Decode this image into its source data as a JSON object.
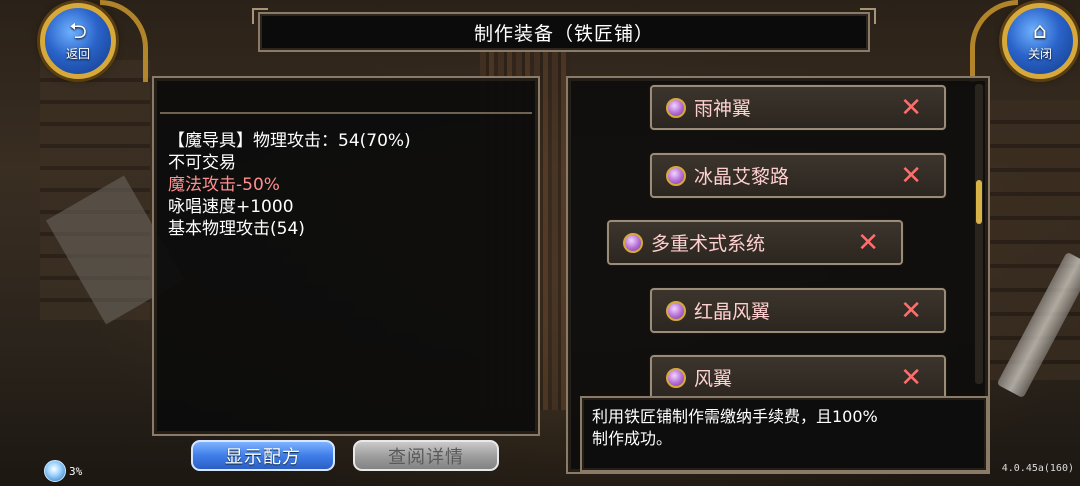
{
  "nav": {
    "back_icon": "return-arrow-icon",
    "back_label": "返回",
    "close_icon": "house-icon",
    "close_label": "关闭"
  },
  "title": "制作装备（铁匠铺）",
  "item_info": {
    "lines": [
      {
        "text": "【魔导具】物理攻击：54(70%)",
        "color": "#ffffff"
      },
      {
        "text": "不可交易",
        "color": "#ffffff"
      },
      {
        "text": "魔法攻击-50%",
        "color": "#ff8f8f"
      },
      {
        "text": "咏唱速度+1000",
        "color": "#ffffff"
      },
      {
        "text": "基本物理攻击(54)",
        "color": "#ffffff"
      }
    ]
  },
  "buttons": {
    "show_recipe": "显示配方",
    "view_details": "查阅详情"
  },
  "recipes": [
    {
      "name": "雨神翼",
      "icon": "purple-gem-icon",
      "remove_icon": "x-icon",
      "remove": "✕"
    },
    {
      "name": "冰晶艾黎路",
      "icon": "purple-gem-icon",
      "remove_icon": "x-icon",
      "remove": "✕"
    },
    {
      "name": "多重术式系统",
      "icon": "purple-gem-icon",
      "remove_icon": "x-icon",
      "remove": "✕",
      "selected": true
    },
    {
      "name": "红晶风翼",
      "icon": "purple-gem-icon",
      "remove_icon": "x-icon",
      "remove": "✕"
    },
    {
      "name": "风翼",
      "icon": "purple-gem-icon",
      "remove_icon": "x-icon",
      "remove": "✕"
    }
  ],
  "message": {
    "line1": "利用铁匠铺制作需缴纳手续费，且100%",
    "line2": "制作成功。"
  },
  "status": {
    "icon": "loading-circle-icon",
    "percent": "3%"
  },
  "version": "4.0.45a(160)",
  "colors": {
    "accent_gold": "#d7a93b",
    "negative_stat": "#ff8f8f",
    "remove_x": "#ff6d6d",
    "primary_button": "#3f7ee8"
  }
}
